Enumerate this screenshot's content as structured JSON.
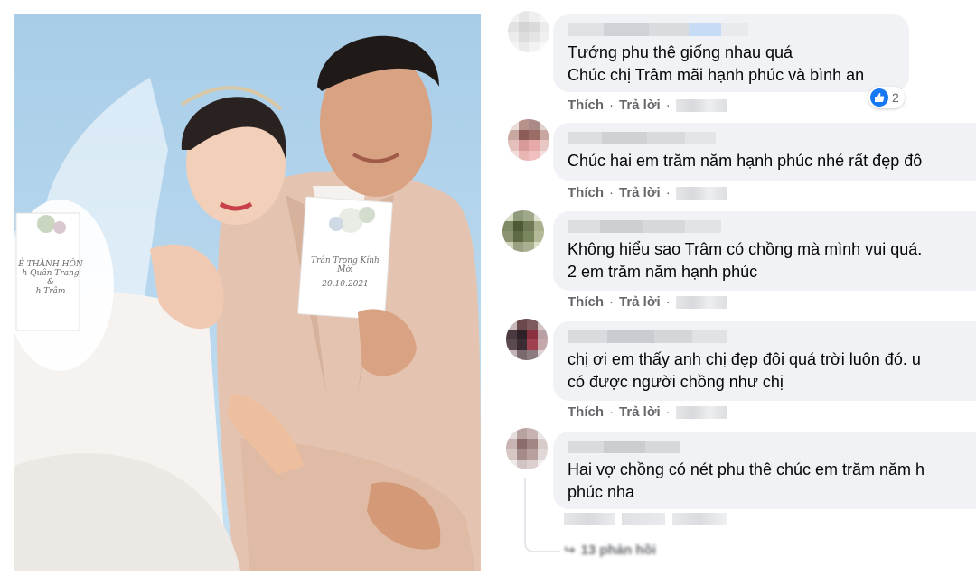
{
  "photo": {
    "alt": "wedding-couple-photo",
    "card_left_lines": [
      "Ẻ THÀNH HÔN",
      "h Quân Trang",
      "&",
      "h Trâm"
    ],
    "card_right_lines": [
      "Trân Trọng Kính Mời",
      "20.10.2021"
    ]
  },
  "comments": [
    {
      "lines": [
        "Tướng phu thê giống nhau quá",
        "Chúc chị Trâm mãi hạnh phúc và bình an"
      ],
      "actions": {
        "like": "Thích",
        "reply": "Trả lời"
      },
      "reaction_count": "2"
    },
    {
      "lines": [
        "Chúc hai em trăm năm hạnh phúc nhé rất đẹp đô"
      ],
      "actions": {
        "like": "Thích",
        "reply": "Trả lời"
      }
    },
    {
      "lines": [
        "Không hiểu sao Trâm có chồng mà mình vui quá.",
        "2 em trăm năm hạnh phúc"
      ],
      "actions": {
        "like": "Thích",
        "reply": "Trả lời"
      }
    },
    {
      "lines": [
        "chị ơi em thấy anh chị đẹp đôi quá trời luôn đó. u",
        "có được người chồng như chị"
      ],
      "actions": {
        "like": "Thích",
        "reply": "Trả lời"
      }
    },
    {
      "lines": [
        "Hai vợ chồng có nét phu thê chúc em trăm năm h",
        "phúc nha"
      ]
    }
  ],
  "more_replies": "13 phản hồi",
  "colors": {
    "bubble": "#f0f2f5",
    "meta": "#65676b",
    "text": "#050505",
    "like_blue": "#1877f2"
  },
  "icons": {
    "reaction": "like-thumb-icon",
    "reply_arrow": "reply-arrow-icon"
  }
}
